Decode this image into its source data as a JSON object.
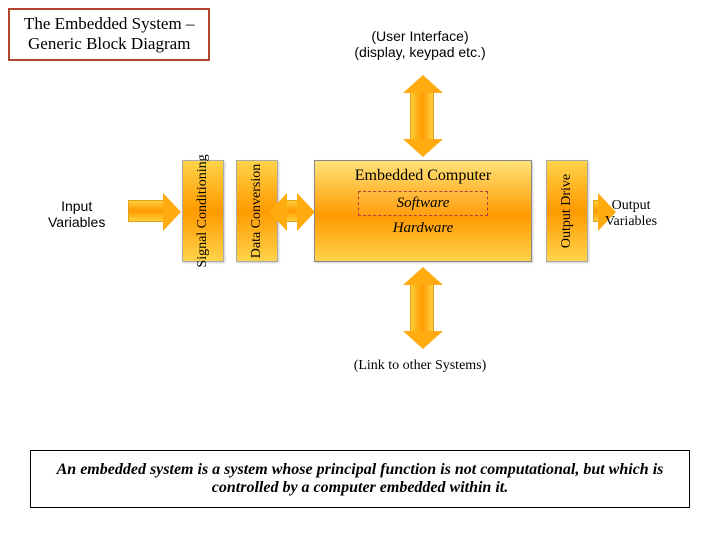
{
  "title": {
    "line1": "The Embedded System –",
    "line2": "Generic Block Diagram"
  },
  "labels": {
    "ui_line1": "(User Interface)",
    "ui_line2": "(display, keypad etc.)",
    "link": "(Link to other Systems)",
    "input_line1": "Input",
    "input_line2": "Variables",
    "output_line1": "Output",
    "output_line2": "Variables"
  },
  "blocks": {
    "signal_conditioning": "Signal Conditioning",
    "data_conversion": "Data Conversion",
    "output_drive": "Output Drive",
    "embedded_computer": "Embedded Computer",
    "software": "Software",
    "hardware": "Hardware"
  },
  "caption": "An embedded system is a system whose principal function is not computational, but which is controlled by a computer embedded within it."
}
